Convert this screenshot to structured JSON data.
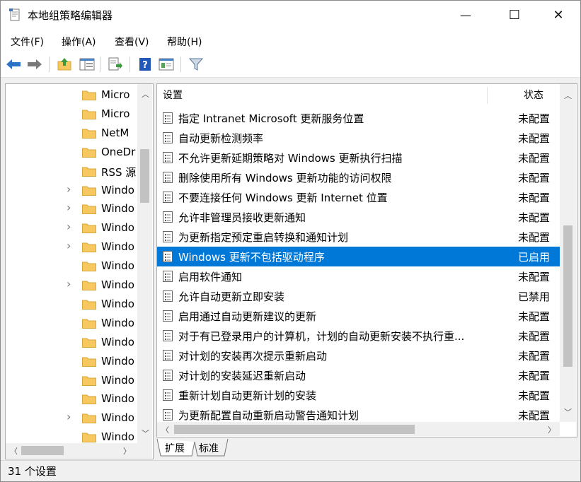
{
  "window": {
    "title": "本地组策略编辑器"
  },
  "caption": {
    "minimize": "—",
    "maximize": "☐",
    "close": "✕"
  },
  "menu": [
    "文件(F)",
    "操作(A)",
    "查看(V)",
    "帮助(H)"
  ],
  "toolbar": {
    "icons": [
      "back-icon",
      "forward-icon",
      "up-folder-icon",
      "show-hide-tree-icon",
      "export-list-icon",
      "help-icon",
      "properties-view-icon",
      "filter-icon"
    ],
    "colors": {
      "back": "#2b73c7",
      "forward": "#7a7a7a",
      "help": "#2258b6",
      "filter": "#5a7a9a"
    }
  },
  "tree": {
    "items": [
      {
        "label": "Micro",
        "expandable": false
      },
      {
        "label": "Micro",
        "expandable": false
      },
      {
        "label": "NetM",
        "expandable": false
      },
      {
        "label": "OneDr",
        "expandable": false
      },
      {
        "label": "RSS 源",
        "expandable": false
      },
      {
        "label": "Windo",
        "expandable": true
      },
      {
        "label": "Windo",
        "expandable": true
      },
      {
        "label": "Windo",
        "expandable": true
      },
      {
        "label": "Windo",
        "expandable": true
      },
      {
        "label": "Windo",
        "expandable": false
      },
      {
        "label": "Windo",
        "expandable": true
      },
      {
        "label": "Windo",
        "expandable": false
      },
      {
        "label": "Windo",
        "expandable": false
      },
      {
        "label": "Windo",
        "expandable": false
      },
      {
        "label": "Windo",
        "expandable": false
      },
      {
        "label": "Windo",
        "expandable": false
      },
      {
        "label": "Windo",
        "expandable": false
      },
      {
        "label": "Windo",
        "expandable": true
      },
      {
        "label": "Windo",
        "expandable": false
      }
    ]
  },
  "list": {
    "header_setting": "设置",
    "header_state": "状态",
    "rows": [
      {
        "name": "指定 Intranet Microsoft 更新服务位置",
        "state": "未配置",
        "selected": false
      },
      {
        "name": "自动更新检测频率",
        "state": "未配置",
        "selected": false
      },
      {
        "name": "不允许更新延期策略对 Windows 更新执行扫描",
        "state": "未配置",
        "selected": false
      },
      {
        "name": "删除使用所有 Windows 更新功能的访问权限",
        "state": "未配置",
        "selected": false
      },
      {
        "name": "不要连接任何 Windows 更新 Internet 位置",
        "state": "未配置",
        "selected": false
      },
      {
        "name": "允许非管理员接收更新通知",
        "state": "未配置",
        "selected": false
      },
      {
        "name": "为更新指定预定重启转换和通知计划",
        "state": "未配置",
        "selected": false
      },
      {
        "name": "Windows 更新不包括驱动程序",
        "state": "已启用",
        "selected": true
      },
      {
        "name": "启用软件通知",
        "state": "未配置",
        "selected": false
      },
      {
        "name": "允许自动更新立即安装",
        "state": "已禁用",
        "selected": false
      },
      {
        "name": "启用通过自动更新建议的更新",
        "state": "未配置",
        "selected": false
      },
      {
        "name": "对于有已登录用户的计算机，计划的自动更新安装不执行重...",
        "state": "未配置",
        "selected": false
      },
      {
        "name": "对计划的安装再次提示重新启动",
        "state": "未配置",
        "selected": false
      },
      {
        "name": "对计划的安装延迟重新启动",
        "state": "未配置",
        "selected": false
      },
      {
        "name": "重新计划自动更新计划的安装",
        "state": "未配置",
        "selected": false
      },
      {
        "name": "为更新配置自动重新启动警告通知计划",
        "state": "未配置",
        "selected": false
      }
    ]
  },
  "tabs": [
    "扩展",
    "标准"
  ],
  "status": {
    "text": "31 个设置"
  },
  "colors": {
    "selection": "#0078d7",
    "folder": "#f6c85f",
    "folder_edge": "#d9a63a"
  }
}
